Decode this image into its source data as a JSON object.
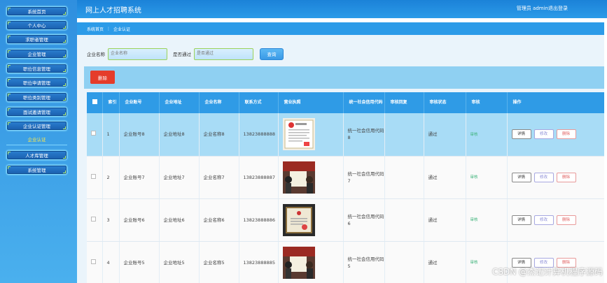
{
  "app": {
    "title": "网上人才招聘系统",
    "user_label": "管理员 admin",
    "logout": "退出登录"
  },
  "sidebar": {
    "items": [
      {
        "label": "系统首页"
      },
      {
        "label": "个人中心"
      },
      {
        "label": "求职者管理"
      },
      {
        "label": "企业管理"
      },
      {
        "label": "职位信息管理"
      },
      {
        "label": "职位申请管理"
      },
      {
        "label": "职位类别管理"
      },
      {
        "label": "面试邀请管理"
      },
      {
        "label": "企业认证管理"
      },
      {
        "label": "人才库管理"
      },
      {
        "label": "系统管理"
      }
    ],
    "active_sub": "企业认证"
  },
  "breadcrumb": {
    "home": "系统首页",
    "separator": "⋮",
    "current": "企业认证"
  },
  "search": {
    "name_label": "企业名称",
    "name_placeholder": "企业名称",
    "pass_label": "是否通过",
    "pass_placeholder": "是否通过",
    "button": "查询"
  },
  "actions": {
    "delete": "删除"
  },
  "table": {
    "headers": [
      "",
      "索引",
      "企业账号",
      "企业地址",
      "企业名称",
      "联系方式",
      "营业执照",
      "统一社会信用代码",
      "审核回复",
      "审核状态",
      "审核",
      "操作"
    ],
    "rows": [
      {
        "index": "1",
        "account": "企业账号8",
        "address": "企业地址8",
        "name": "企业名称8",
        "phone": "13823888888",
        "credit_code": "统一社会信用代码8",
        "reply": "",
        "status": "通过",
        "audit": "审核"
      },
      {
        "index": "2",
        "account": "企业账号7",
        "address": "企业地址7",
        "name": "企业名称7",
        "phone": "13823888887",
        "credit_code": "统一社会信用代码7",
        "reply": "",
        "status": "通过",
        "audit": "审核"
      },
      {
        "index": "3",
        "account": "企业账号6",
        "address": "企业地址6",
        "name": "企业名称6",
        "phone": "13823888886",
        "credit_code": "统一社会信用代码6",
        "reply": "",
        "status": "通过",
        "audit": "审核"
      },
      {
        "index": "4",
        "account": "企业账号5",
        "address": "企业地址5",
        "name": "企业名称5",
        "phone": "13823888885",
        "credit_code": "统一社会信用代码5",
        "reply": "",
        "status": "通过",
        "audit": "审核"
      }
    ],
    "op_labels": {
      "detail": "详情",
      "edit": "修改",
      "delete": "删除"
    }
  },
  "watermark": "CSDN @杰记计算机程序源码",
  "colors": {
    "header_blue": "#2f9be6",
    "delete_red": "#e53c2a",
    "row_highlight": "#a8dcf6",
    "sidebar": "#2f8fdf"
  }
}
